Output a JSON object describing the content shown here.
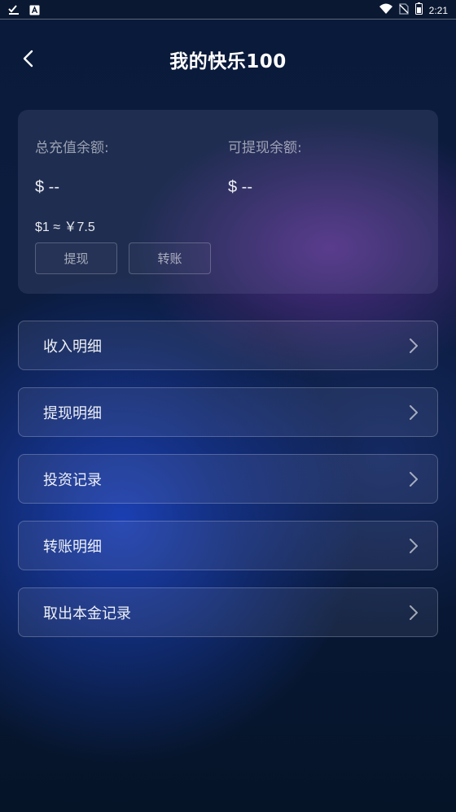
{
  "status_bar": {
    "time": "2:21",
    "icons": [
      "check-download-icon",
      "a-badge-icon",
      "wifi-icon",
      "no-sim-icon",
      "battery-icon"
    ]
  },
  "header": {
    "title": "我的快乐100",
    "back_icon": "chevron-left-icon"
  },
  "balance_card": {
    "total_recharge_label": "总充值余额:",
    "total_recharge_value": "$ --",
    "withdrawable_label": "可提现余额:",
    "withdrawable_value": "$ --",
    "exchange_rate": "$1 ≈ ￥7.5",
    "withdraw_button": "提现",
    "transfer_button": "转账"
  },
  "menu": [
    {
      "label": "收入明细"
    },
    {
      "label": "提现明细"
    },
    {
      "label": "投资记录"
    },
    {
      "label": "转账明细"
    },
    {
      "label": "取出本金记录"
    }
  ],
  "colors": {
    "background_top": "#0a1a3a",
    "background_bottom": "#061428",
    "accent_purple": "#6c34a0",
    "accent_blue": "#1e46c8"
  }
}
